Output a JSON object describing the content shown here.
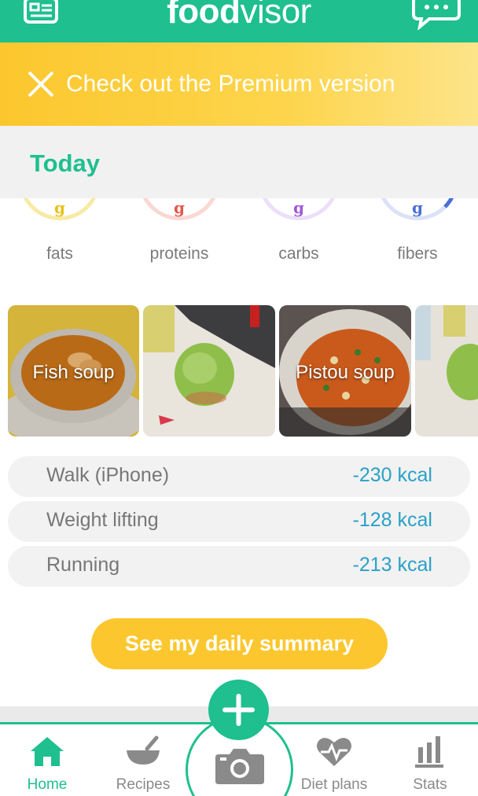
{
  "header": {
    "logo_bold": "food",
    "logo_rest": "visor"
  },
  "premium": {
    "text": "Check out the Premium version"
  },
  "today": {
    "label": "Today"
  },
  "macros": [
    {
      "unit": "g",
      "label": "fats",
      "color": "#f5e27a",
      "unit_color": "#e8c21a"
    },
    {
      "unit": "g",
      "label": "proteins",
      "color": "#f8c8c0",
      "unit_color": "#e2584a"
    },
    {
      "unit": "g",
      "label": "carbs",
      "color": "#e4d2f5",
      "unit_color": "#a05ad6"
    },
    {
      "unit": "g",
      "label": "fibers",
      "color": "#cfd8f5",
      "unit_color": "#4a6fd6"
    }
  ],
  "meals": [
    {
      "name": "Fish soup"
    },
    {
      "name": ""
    },
    {
      "name": "Pistou soup"
    },
    {
      "name": ""
    }
  ],
  "activities": [
    {
      "name": "Walk (iPhone)",
      "kcal": "-230 kcal"
    },
    {
      "name": "Weight lifting",
      "kcal": "-128 kcal"
    },
    {
      "name": "Running",
      "kcal": "-213 kcal"
    }
  ],
  "summary_button": "See my daily summary",
  "tabs": [
    {
      "label": "Home",
      "icon": "home-icon",
      "active": true
    },
    {
      "label": "Recipes",
      "icon": "bowl-icon",
      "active": false
    },
    {
      "label": "Diet plans",
      "icon": "heart-pulse-icon",
      "active": false
    },
    {
      "label": "Stats",
      "icon": "bar-chart-icon",
      "active": false
    }
  ],
  "colors": {
    "brand": "#1fbf8f",
    "accent": "#fcc72e",
    "kcal": "#2aa1c7"
  }
}
